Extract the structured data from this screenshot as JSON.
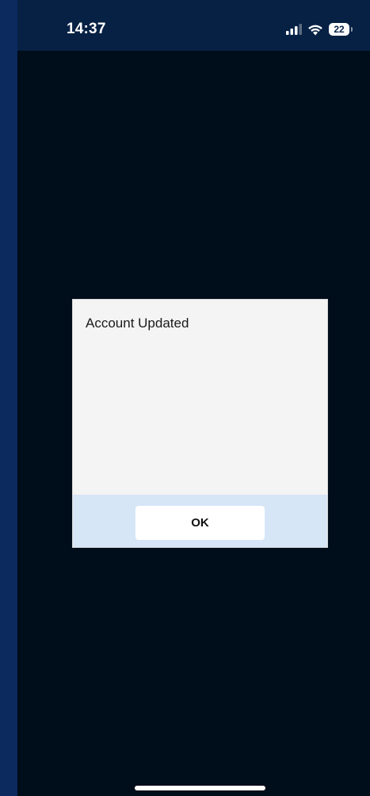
{
  "status_bar": {
    "time": "14:37",
    "battery_level": "22",
    "icons": [
      "signal-icon",
      "wifi-icon",
      "battery-icon"
    ]
  },
  "dialog": {
    "message": "Account Updated",
    "ok_label": "OK"
  },
  "colors": {
    "background": "#000d1a",
    "status_bar": "#062144",
    "frame": "#0c2a5e",
    "dialog_body": "#f4f4f4",
    "dialog_footer": "#d6e6f7",
    "button": "#ffffff"
  }
}
